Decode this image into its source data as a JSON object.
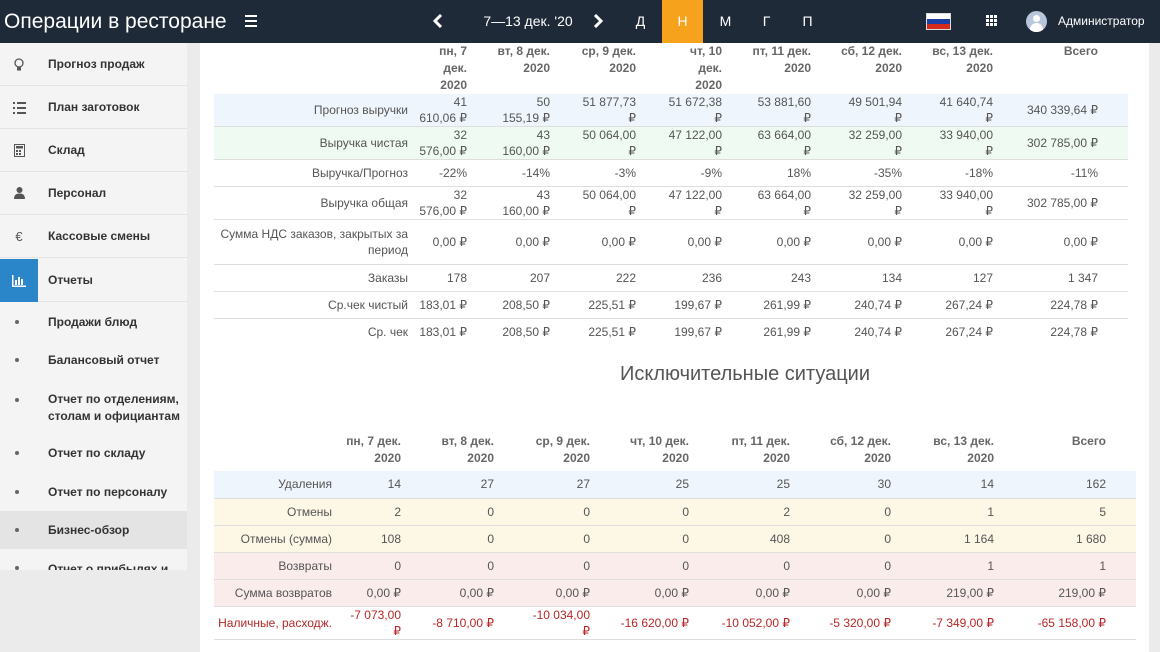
{
  "app": {
    "title": "Операции в ресторане"
  },
  "topbar": {
    "week_label": "7—13 дек. '20",
    "periods": [
      {
        "label": "Д",
        "active": false
      },
      {
        "label": "Н",
        "active": true
      },
      {
        "label": "М",
        "active": false
      },
      {
        "label": "Г",
        "active": false
      },
      {
        "label": "П",
        "active": false
      }
    ],
    "user_name": "Администратор",
    "accent_color": "#f6a21d",
    "bar_color": "#1f2a38"
  },
  "sidebar": {
    "items": [
      {
        "label": "Прогноз продаж",
        "icon": "lightbulb-icon"
      },
      {
        "label": "План заготовок",
        "icon": "list-icon"
      },
      {
        "label": "Склад",
        "icon": "calculator-icon"
      },
      {
        "label": "Персонал",
        "icon": "user-icon"
      },
      {
        "label": "Кассовые смены",
        "icon": "euro-icon"
      },
      {
        "label": "Отчеты",
        "icon": "bar-chart-icon",
        "active": true
      }
    ],
    "subitems": [
      {
        "label": "Продажи блюд"
      },
      {
        "label": "Балансовый отчет"
      },
      {
        "label": "Отчет по отделениям, столам и официантам"
      },
      {
        "label": "Отчет по складу"
      },
      {
        "label": "Отчет по персоналу"
      },
      {
        "label": "Бизнес-обзор",
        "active": true
      },
      {
        "label": "Отчет о прибылях и"
      }
    ]
  },
  "sales_table": {
    "columns": [
      {
        "day": "пн, 7 дек.",
        "year": "2020"
      },
      {
        "day": "вт, 8 дек.",
        "year": "2020"
      },
      {
        "day": "ср, 9 дек.",
        "year": "2020"
      },
      {
        "day": "чт, 10 дек.",
        "year": "2020"
      },
      {
        "day": "пт, 11 дек.",
        "year": "2020"
      },
      {
        "day": "сб, 12 дек.",
        "year": "2020"
      },
      {
        "day": "вс, 13 дек.",
        "year": "2020"
      },
      {
        "day": "Всего",
        "year": ""
      }
    ],
    "rows": [
      {
        "label": "Прогноз выручки",
        "style": "blue",
        "values": [
          "41 610,06 ₽",
          "50 155,19 ₽",
          "51 877,73 ₽",
          "51 672,38 ₽",
          "53 881,60 ₽",
          "49 501,94 ₽",
          "41 640,74 ₽",
          "340 339,64 ₽"
        ]
      },
      {
        "label": "Выручка чистая",
        "style": "green",
        "values": [
          "32 576,00 ₽",
          "43 160,00 ₽",
          "50 064,00 ₽",
          "47 122,00 ₽",
          "63 664,00 ₽",
          "32 259,00 ₽",
          "33 940,00 ₽",
          "302 785,00 ₽"
        ]
      },
      {
        "label": "Выручка/Прогноз",
        "style": "",
        "values": [
          "-22%",
          "-14%",
          "-3%",
          "-9%",
          "18%",
          "-35%",
          "-18%",
          "-11%"
        ]
      },
      {
        "label": "Выручка общая",
        "style": "",
        "values": [
          "32 576,00 ₽",
          "43 160,00 ₽",
          "50 064,00 ₽",
          "47 122,00 ₽",
          "63 664,00 ₽",
          "32 259,00 ₽",
          "33 940,00 ₽",
          "302 785,00 ₽"
        ]
      },
      {
        "label": "Сумма НДС заказов, закрытых за период",
        "style": "tall",
        "values": [
          "0,00 ₽",
          "0,00 ₽",
          "0,00 ₽",
          "0,00 ₽",
          "0,00 ₽",
          "0,00 ₽",
          "0,00 ₽",
          "0,00 ₽"
        ]
      },
      {
        "label": "Заказы",
        "style": "",
        "values": [
          "178",
          "207",
          "222",
          "236",
          "243",
          "134",
          "127",
          "1 347"
        ]
      },
      {
        "label": "Ср.чек чистый",
        "style": "",
        "values": [
          "183,01 ₽",
          "208,50 ₽",
          "225,51 ₽",
          "199,67 ₽",
          "261,99 ₽",
          "240,74 ₽",
          "267,24 ₽",
          "224,78 ₽"
        ]
      },
      {
        "label": "Ср. чек",
        "style": "noborder",
        "values": [
          "183,01 ₽",
          "208,50 ₽",
          "225,51 ₽",
          "199,67 ₽",
          "261,99 ₽",
          "240,74 ₽",
          "267,24 ₽",
          "224,78 ₽"
        ]
      }
    ]
  },
  "exceptions": {
    "title": "Исключительные ситуации",
    "columns": [
      {
        "day": "пн, 7 дек.",
        "year": "2020"
      },
      {
        "day": "вт, 8 дек.",
        "year": "2020"
      },
      {
        "day": "ср, 9 дек.",
        "year": "2020"
      },
      {
        "day": "чт, 10 дек.",
        "year": "2020"
      },
      {
        "day": "пт, 11 дек.",
        "year": "2020"
      },
      {
        "day": "сб, 12 дек.",
        "year": "2020"
      },
      {
        "day": "вс, 13 дек.",
        "year": "2020"
      },
      {
        "day": "Всего",
        "year": ""
      }
    ],
    "rows": [
      {
        "label": "Удаления",
        "style": "blue",
        "values": [
          "14",
          "27",
          "27",
          "25",
          "25",
          "30",
          "14",
          "162"
        ]
      },
      {
        "label": "Отмены",
        "style": "yellow",
        "values": [
          "2",
          "0",
          "0",
          "0",
          "2",
          "0",
          "1",
          "5"
        ]
      },
      {
        "label": "Отмены (сумма)",
        "style": "yellow",
        "values": [
          "108",
          "0",
          "0",
          "0",
          "408",
          "0",
          "1 164",
          "1 680"
        ]
      },
      {
        "label": "Возвраты",
        "style": "red",
        "values": [
          "0",
          "0",
          "0",
          "0",
          "0",
          "0",
          "1",
          "1"
        ]
      },
      {
        "label": "Сумма возвратов",
        "style": "red",
        "values": [
          "0,00 ₽",
          "0,00 ₽",
          "0,00 ₽",
          "0,00 ₽",
          "0,00 ₽",
          "0,00 ₽",
          "219,00 ₽",
          "219,00 ₽"
        ]
      },
      {
        "label": "Наличные, расходж.",
        "style": "neg",
        "values": [
          "-7 073,00 ₽",
          "-8 710,00 ₽",
          "-10 034,00 ₽",
          "-16 620,00 ₽",
          "-10 052,00 ₽",
          "-5 320,00 ₽",
          "-7 349,00 ₽",
          "-65 158,00 ₽"
        ]
      }
    ]
  }
}
